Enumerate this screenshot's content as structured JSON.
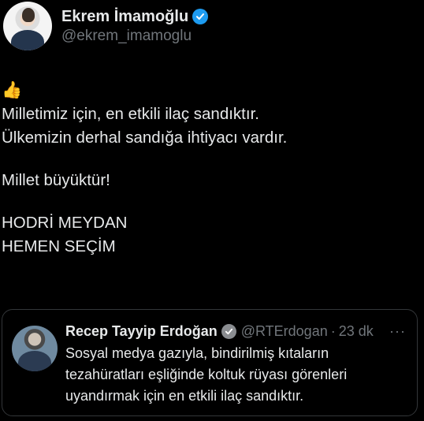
{
  "author": {
    "display_name": "Ekrem İmamoğlu",
    "handle": "@ekrem_imamoglu"
  },
  "tweet": {
    "emoji": "👍",
    "lines": [
      "Milletimiz için, en etkili ilaç sandıktır.",
      "Ülkemizin derhal sandığa ihtiyacı vardır.",
      "Millet büyüktür!",
      "HODRİ MEYDAN",
      "HEMEN SEÇİM"
    ]
  },
  "quoted": {
    "display_name": "Recep Tayyip Erdoğan",
    "handle": "@RTErdogan",
    "separator": "·",
    "time": "23 dk",
    "more": "···",
    "lines": [
      "Sosyal medya gazıyla, bindirilmiş kıtaların",
      "tezahüratları eşliğinde koltuk rüyası görenleri",
      "uyandırmak için en etkili ilaç sandıktır."
    ]
  },
  "colors": {
    "background": "#000000",
    "text": "#e7e9ea",
    "muted": "#71767b",
    "verified_blue": "#1d9bf0",
    "verified_gray": "#8a8d91",
    "border": "#333639"
  }
}
